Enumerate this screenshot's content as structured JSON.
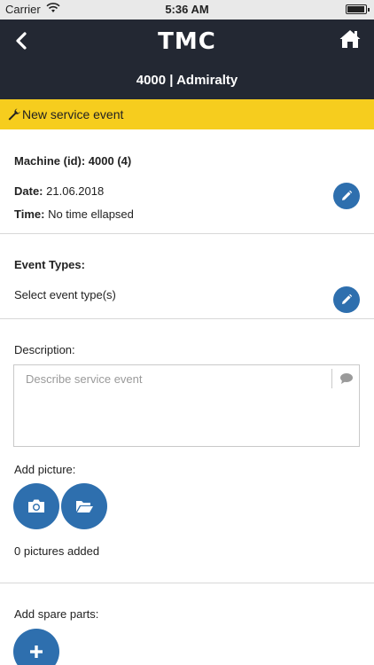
{
  "status_bar": {
    "carrier": "Carrier",
    "time": "5:36 AM",
    "battery_level": 0.95
  },
  "nav": {
    "logo": "TMC",
    "title": "4000 | Admiralty"
  },
  "banner": {
    "label": "New service event"
  },
  "machine": {
    "label": "Machine (id):",
    "value": "4000 (4)"
  },
  "date": {
    "label": "Date:",
    "value": "21.06.2018"
  },
  "time_field": {
    "label": "Time:",
    "value": "No time ellapsed"
  },
  "event_types": {
    "label": "Event Types:",
    "value": "Select event type(s)"
  },
  "description": {
    "label": "Description:",
    "placeholder": "Describe service event"
  },
  "pictures": {
    "label": "Add picture:",
    "count_text": "0 pictures added"
  },
  "spare_parts": {
    "label": "Add spare parts:"
  },
  "colors": {
    "nav_bg": "#232833",
    "banner_bg": "#f6cd1e",
    "accent": "#2e6fae"
  }
}
